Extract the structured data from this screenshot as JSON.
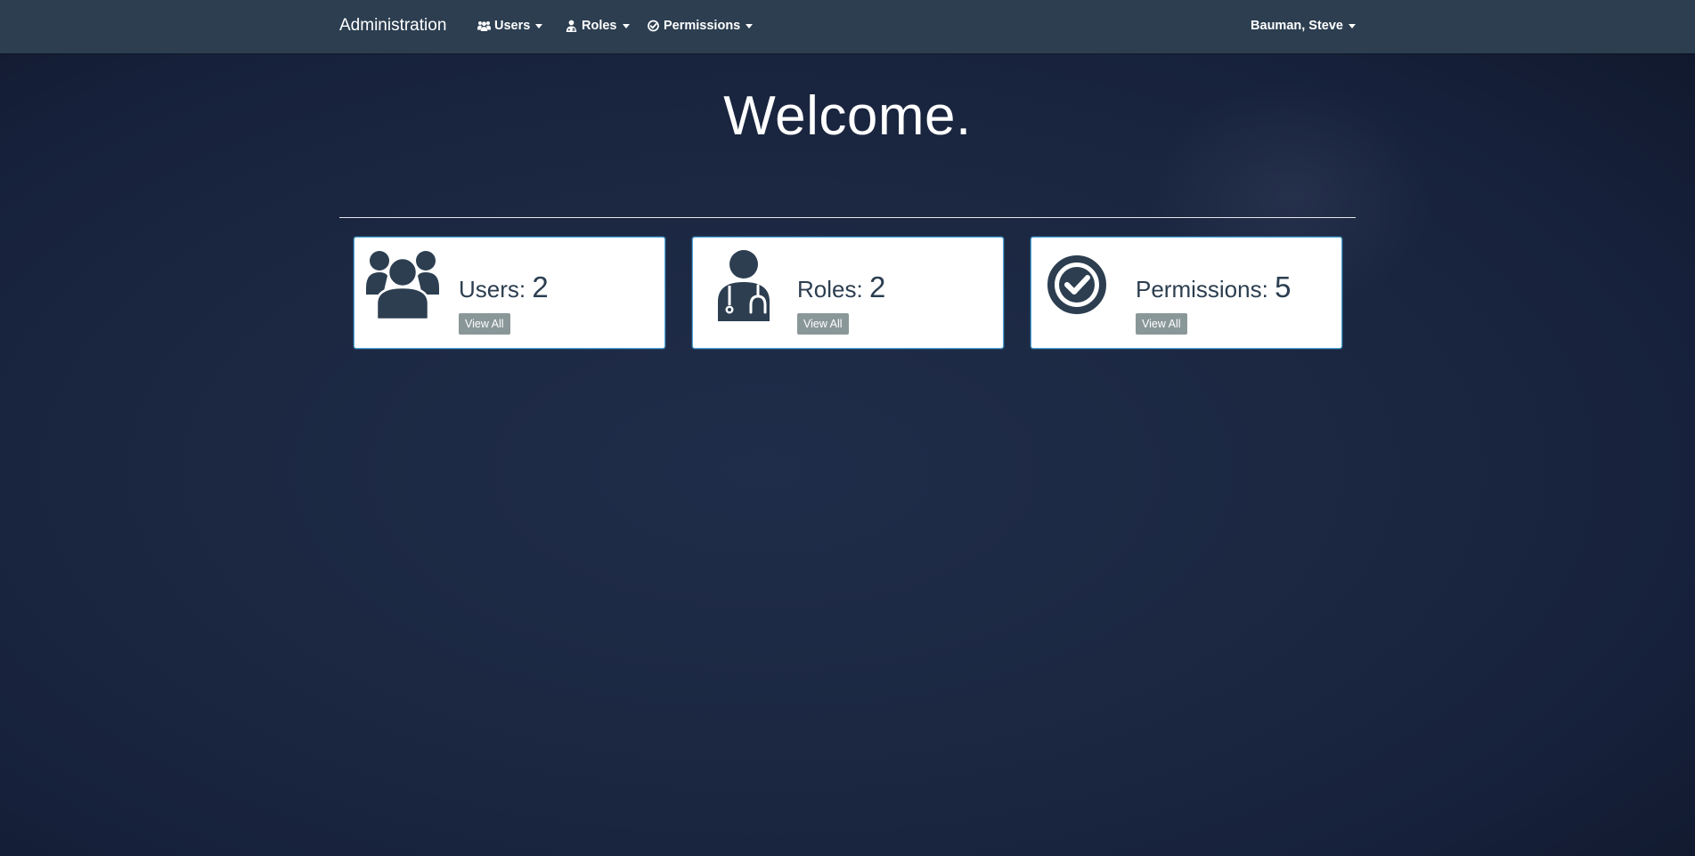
{
  "navbar": {
    "brand": "Administration",
    "items": [
      {
        "label": "Users",
        "icon": "users-icon"
      },
      {
        "label": "Roles",
        "icon": "user-md-icon"
      },
      {
        "label": "Permissions",
        "icon": "check-circle-icon"
      }
    ],
    "user_menu": "Bauman, Steve"
  },
  "hero": {
    "title": "Welcome."
  },
  "cards": [
    {
      "label": "Users:",
      "count": "2",
      "button": "View All",
      "icon": "users-icon"
    },
    {
      "label": "Roles:",
      "count": "2",
      "button": "View All",
      "icon": "doctor-icon"
    },
    {
      "label": "Permissions:",
      "count": "5",
      "button": "View All",
      "icon": "check-circle-icon"
    }
  ],
  "colors": {
    "navbar_bg": "#2c3e50",
    "page_bg": "#1c2842",
    "card_border": "#4aa3d9",
    "icon_color": "#2c3e50",
    "button_bg": "#8a9799"
  }
}
